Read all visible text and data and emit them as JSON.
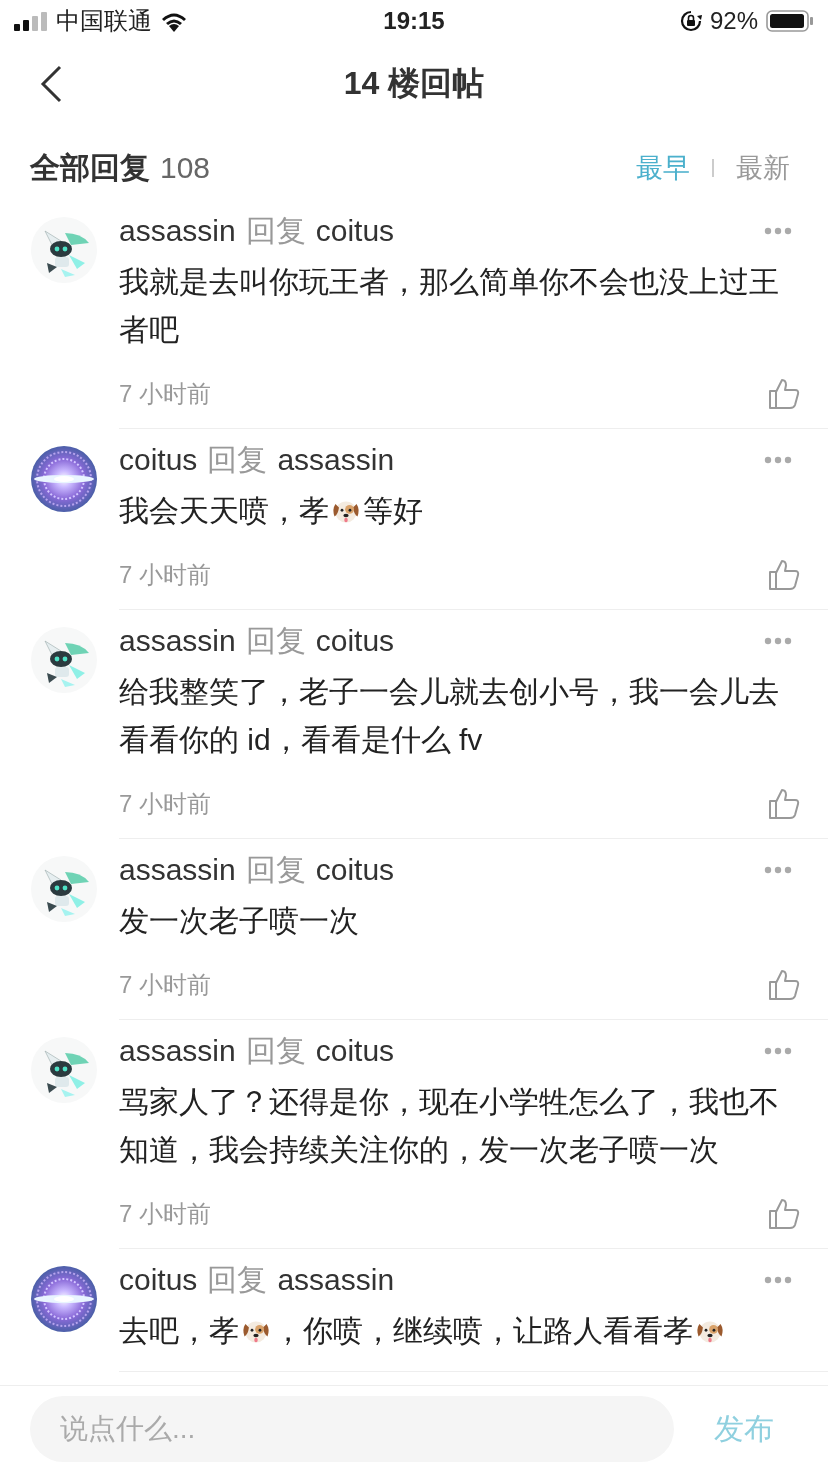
{
  "status_bar": {
    "carrier": "中国联通",
    "time": "19:15",
    "battery": "92%"
  },
  "nav": {
    "title": "14 楼回帖"
  },
  "header": {
    "label": "全部回复",
    "count": "108",
    "sort_tabs": [
      {
        "label": "最早",
        "selected": true
      },
      {
        "label": "最新",
        "selected": false
      }
    ]
  },
  "comments": [
    {
      "author": "assassin",
      "reply_word": "回复",
      "target": "coitus",
      "avatar": {
        "kind": "robot"
      },
      "body": [
        {
          "kind": "text",
          "text": "我就是去叫你玩王者，那么简单你不会也没上过王者吧"
        }
      ],
      "time": "7 小时前"
    },
    {
      "author": "coitus",
      "reply_word": "回复",
      "target": "assassin",
      "avatar": {
        "kind": "orb"
      },
      "body": [
        {
          "kind": "text",
          "text": "我会天天喷，孝"
        },
        {
          "kind": "dog_emoji"
        },
        {
          "kind": "text",
          "text": "等好"
        }
      ],
      "time": "7 小时前"
    },
    {
      "author": "assassin",
      "reply_word": "回复",
      "target": "coitus",
      "avatar": {
        "kind": "robot"
      },
      "body": [
        {
          "kind": "text",
          "text": "给我整笑了，老子一会儿就去创小号，我一会儿去看看你的 id，看看是什么 fv"
        }
      ],
      "time": "7 小时前"
    },
    {
      "author": "assassin",
      "reply_word": "回复",
      "target": "coitus",
      "avatar": {
        "kind": "robot"
      },
      "body": [
        {
          "kind": "text",
          "text": "发一次老子喷一次"
        }
      ],
      "time": "7 小时前"
    },
    {
      "author": "assassin",
      "reply_word": "回复",
      "target": "coitus",
      "avatar": {
        "kind": "robot"
      },
      "body": [
        {
          "kind": "text",
          "text": "骂家人了？还得是你，现在小学牲怎么了，我也不知道，我会持续关注你的，发一次老子喷一次"
        }
      ],
      "time": "7 小时前"
    },
    {
      "author": "coitus",
      "reply_word": "回复",
      "target": "assassin",
      "avatar": {
        "kind": "orb"
      },
      "body": [
        {
          "kind": "text",
          "text": "去吧，孝"
        },
        {
          "kind": "dog_emoji"
        },
        {
          "kind": "text",
          "text": "，你喷，继续喷，让路人看看孝"
        },
        {
          "kind": "dog_emoji"
        }
      ]
    }
  ],
  "composer": {
    "placeholder": "说点什么...",
    "send": "发布"
  }
}
